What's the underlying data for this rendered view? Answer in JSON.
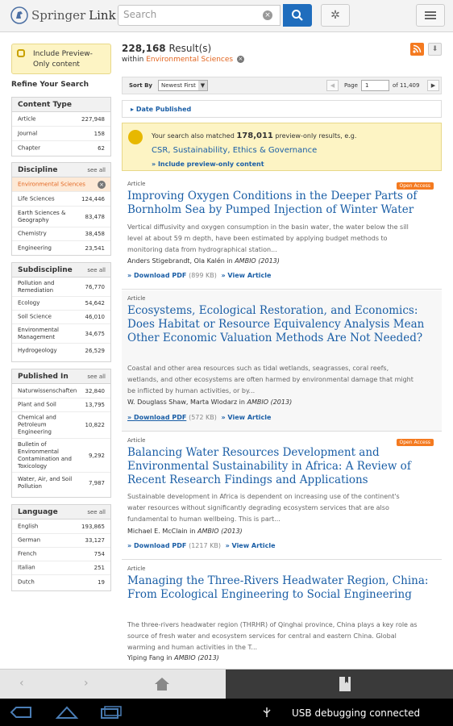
{
  "header": {
    "logo_part1": "Springer",
    "logo_part2": "Link",
    "search_placeholder": "Search",
    "accent": "#1f6dbd"
  },
  "sidebar": {
    "preview_notice": "Include Preview-Only content",
    "refine_title": "Refine Your Search",
    "content_type": {
      "title": "Content Type",
      "rows": [
        {
          "label": "Article",
          "count": "227,948"
        },
        {
          "label": "Journal",
          "count": "158"
        },
        {
          "label": "Chapter",
          "count": "62"
        }
      ]
    },
    "discipline": {
      "title": "Discipline",
      "see_all": "see all",
      "selected": "Environmental Sciences",
      "rows": [
        {
          "label": "Life Sciences",
          "count": "124,446"
        },
        {
          "label": "Earth Sciences & Geography",
          "count": "83,478"
        },
        {
          "label": "Chemistry",
          "count": "38,458"
        },
        {
          "label": "Engineering",
          "count": "23,541"
        }
      ]
    },
    "subdiscipline": {
      "title": "Subdiscipline",
      "see_all": "see all",
      "rows": [
        {
          "label": "Pollution and Remediation",
          "count": "76,770"
        },
        {
          "label": "Ecology",
          "count": "54,642"
        },
        {
          "label": "Soil Science",
          "count": "46,010"
        },
        {
          "label": "Environmental Management",
          "count": "34,675"
        },
        {
          "label": "Hydrogeology",
          "count": "26,529"
        }
      ]
    },
    "published_in": {
      "title": "Published In",
      "see_all": "see all",
      "rows": [
        {
          "label": "Naturwissenschaften",
          "count": "32,840"
        },
        {
          "label": "Plant and Soil",
          "count": "13,795"
        },
        {
          "label": "Chemical and Petroleum Engineering",
          "count": "10,822"
        },
        {
          "label": "Bulletin of Environmental Contamination and Toxicology",
          "count": "9,292"
        },
        {
          "label": "Water, Air, and Soil Pollution",
          "count": "7,987"
        }
      ]
    },
    "language": {
      "title": "Language",
      "see_all": "see all",
      "rows": [
        {
          "label": "English",
          "count": "193,865"
        },
        {
          "label": "German",
          "count": "33,127"
        },
        {
          "label": "French",
          "count": "754"
        },
        {
          "label": "Italian",
          "count": "251"
        },
        {
          "label": "Dutch",
          "count": "19"
        }
      ]
    }
  },
  "main": {
    "results_count": "228,168",
    "results_label": "Result(s)",
    "within_label": "within",
    "within_discipline": "Environmental Sciences",
    "sort_label": "Sort By",
    "sort_value": "Newest First",
    "page_label": "Page",
    "page_value": "1",
    "page_of": "of 11,409",
    "date_published": "Date Published",
    "matched_prefix": "Your search also matched",
    "matched_count": "178,011",
    "matched_suffix": "preview-only results, e.g.",
    "matched_example": "CSR, Sustainability, Ethics & Governance",
    "matched_link": "» Include preview-only content",
    "articles": [
      {
        "type": "Article",
        "open_access": "Open Access",
        "title": "Improving Oxygen Conditions in the Deeper Parts of Bornholm Sea by Pumped Injection of Winter Water",
        "abstract": "Vertical diffusivity and oxygen consumption in the basin water, the water below the sill level at about 59 m depth, have been estimated by applying budget methods to monitoring data from hydrographical station...",
        "authors": "Anders Stigebrandt, Ola Kalén in",
        "journal": "AMBIO (2013)",
        "download": "» Download PDF",
        "size": "(899 KB)",
        "view": "» View Article"
      },
      {
        "type": "Article",
        "open_access": "",
        "title": "Ecosystems, Ecological Restoration, and Economics: Does Habitat or Resource Equivalency Analysis Mean Other Economic Valuation Methods Are Not Needed?",
        "abstract": "Coastal and other area resources such as tidal wetlands, seagrasses, coral reefs, wetlands, and other ecosystems are often harmed by environmental damage that might be inflicted by human activities, or by...",
        "authors": "W. Douglass Shaw, Marta Wlodarz in",
        "journal": "AMBIO (2013)",
        "download": "» Download PDF",
        "size": "(572 KB)",
        "view": "» View Article"
      },
      {
        "type": "Article",
        "open_access": "Open Access",
        "title": "Balancing Water Resources Development and Environmental Sustainability in Africa: A Review of Recent Research Findings and Applications",
        "abstract": "Sustainable development in Africa is dependent on increasing use of the continent's water resources without significantly degrading ecosystem services that are also fundamental to human wellbeing. This is part...",
        "authors": "Michael E. McClain in",
        "journal": "AMBIO (2013)",
        "download": "» Download PDF",
        "size": "(1217 KB)",
        "view": "» View Article"
      },
      {
        "type": "Article",
        "open_access": "",
        "title": "Managing the Three-Rivers Headwater Region, China: From Ecological Engineering to Social Engineering",
        "abstract": "The three-rivers headwater region (THRHR) of Qinghai province, China plays a key role as source of fresh water and ecosystem services for central and eastern China. Global warming and human activities in the T...",
        "authors": "Yiping Fang in",
        "journal": "AMBIO (2013)"
      }
    ]
  },
  "status": {
    "usb": "USB debugging connected"
  }
}
